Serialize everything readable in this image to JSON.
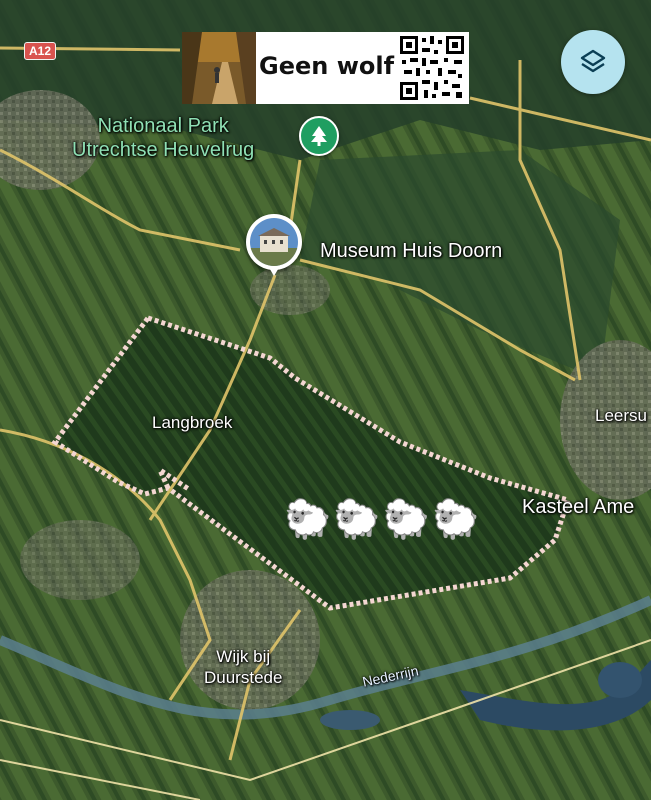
{
  "map": {
    "road_shield": "A12",
    "banner_text": "Geen wolf",
    "places": {
      "park_line1": "Nationaal Park",
      "park_line2": "Utrechtse Heuvelrug",
      "museum": "Museum Huis Doorn",
      "langbroek": "Langbroek",
      "leersum": "Leersu",
      "kasteel": "Kasteel Ame",
      "wijk_line1": "Wijk bij",
      "wijk_line2": "Duurstede",
      "river": "Nederrijn"
    },
    "sheep": "🐑🐑🐑🐑",
    "icons": {
      "park": "tree-icon",
      "museum": "museum-photo-icon",
      "layers": "layers-icon",
      "qr": "qr-code-icon",
      "photo": "forest-path-photo"
    },
    "colors": {
      "park_pin": "#1f9e61",
      "park_label": "#8fe0b4",
      "area_outline": "#f4d7d2",
      "layers_button": "#b5e3ef",
      "road_shield": "#d9534f"
    }
  }
}
